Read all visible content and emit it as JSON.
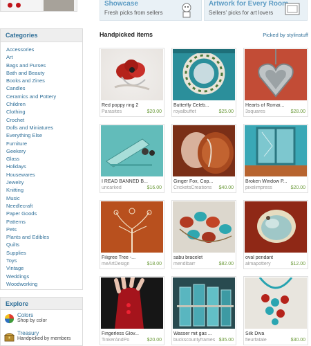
{
  "banner": {
    "promo1": {
      "title": "Showcase",
      "subtitle": "Fresh picks from sellers"
    },
    "promo2": {
      "title": "Artwork for Every Room",
      "subtitle": "Sellers' picks for art lovers"
    }
  },
  "sidebar": {
    "heading": "Categories",
    "items": [
      "Accessories",
      "Art",
      "Bags and Purses",
      "Bath and Beauty",
      "Books and Zines",
      "Candles",
      "Ceramics and Pottery",
      "Children",
      "Clothing",
      "Crochet",
      "Dolls and Miniatures",
      "Everything Else",
      "Furniture",
      "Geekery",
      "Glass",
      "Holidays",
      "Housewares",
      "Jewelry",
      "Knitting",
      "Music",
      "Needlecraft",
      "Paper Goods",
      "Patterns",
      "Pets",
      "Plants and Edibles",
      "Quilts",
      "Supplies",
      "Toys",
      "Vintage",
      "Weddings",
      "Woodworking"
    ]
  },
  "explore": {
    "heading": "Explore",
    "items": [
      {
        "title": "Colors",
        "subtitle": "Shop by color",
        "icon": "color-wheel-icon"
      },
      {
        "title": "Treasury",
        "subtitle": "Handpicked by members",
        "icon": "treasure-chest-icon"
      }
    ]
  },
  "main": {
    "title": "Handpicked items",
    "picked_by_prefix": "Picked by",
    "picked_by_user": "stylinstuff"
  },
  "items": [
    {
      "title": "Red poppy ring 2",
      "shop": "Parasites",
      "price": "$20.00"
    },
    {
      "title": "Butterfly Celeb...",
      "shop": "royalbuffet",
      "price": "$25.00"
    },
    {
      "title": "Hearts of Romai...",
      "shop": "3squares",
      "price": "$28.00"
    },
    {
      "title": "I READ BANNED B...",
      "shop": "uncarked",
      "price": "$16.00"
    },
    {
      "title": "Ginger Fox, Cop...",
      "shop": "CricketsCreations",
      "price": "$40.00"
    },
    {
      "title": "Broken Window P...",
      "shop": "pixelimpress",
      "price": "$20.00"
    },
    {
      "title": "Filigree Tree -...",
      "shop": "meArtDesign",
      "price": "$18.00"
    },
    {
      "title": "sabu bracelet",
      "shop": "mendlbarr",
      "price": "$82.00"
    },
    {
      "title": "oval pendant",
      "shop": "almapottery",
      "price": "$12.00"
    },
    {
      "title": "Fingerless Glov...",
      "shop": "TinkerAndPo",
      "price": "$20.00"
    },
    {
      "title": "Wasser mit gas ...",
      "shop": "buckscountyframes",
      "price": "$35.00"
    },
    {
      "title": "Silk Diva",
      "shop": "fleurfatale",
      "price": "$30.00"
    }
  ]
}
